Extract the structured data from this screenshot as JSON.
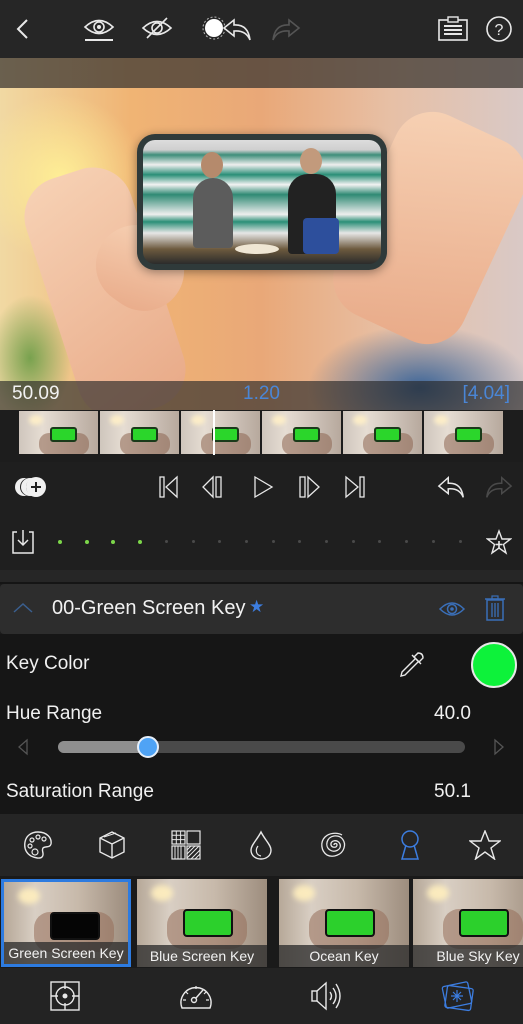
{
  "toolbar": {
    "icons": [
      "back-chevron",
      "show-original",
      "hide-original",
      "mask-undo",
      "redo",
      "clipboard",
      "help"
    ],
    "help_label": "?"
  },
  "timeline": {
    "start_time": "50.09",
    "current_time": "1.20",
    "duration": "[4.04]",
    "frame_count": 6,
    "playhead_position_frames": 2.4
  },
  "keyframes": {
    "active_dots": 4,
    "total_dots": 16,
    "active_color": "#7cd64a",
    "inactive_color": "#4a4a4a"
  },
  "effect": {
    "title": "00-Green Screen Key",
    "favorite_marker": "★",
    "accent_color": "#3c7de0"
  },
  "params": {
    "key_color_label": "Key Color",
    "key_color_value": "#0df23a",
    "hue_range_label": "Hue Range",
    "hue_range_value": "40.0",
    "hue_range_slider_fraction": 0.22,
    "saturation_range_label": "Saturation Range",
    "saturation_range_value": "50.1"
  },
  "categories": [
    {
      "name": "color-palette",
      "active": false
    },
    {
      "name": "3d-cube",
      "active": false
    },
    {
      "name": "texture-grid",
      "active": false
    },
    {
      "name": "water-drop",
      "active": false
    },
    {
      "name": "spiral",
      "active": false
    },
    {
      "name": "keyhole",
      "active": true
    },
    {
      "name": "favorites-star",
      "active": false
    }
  ],
  "presets": [
    {
      "label": "Green Screen Key",
      "selected": true
    },
    {
      "label": "Blue Screen Key",
      "selected": false
    },
    {
      "label": "Ocean Key",
      "selected": false
    },
    {
      "label": "Blue Sky Key",
      "selected": false
    }
  ],
  "bottom_nav": [
    {
      "name": "crop-target",
      "active": false
    },
    {
      "name": "speed-gauge",
      "active": false
    },
    {
      "name": "audio",
      "active": false
    },
    {
      "name": "effects",
      "active": true
    }
  ]
}
